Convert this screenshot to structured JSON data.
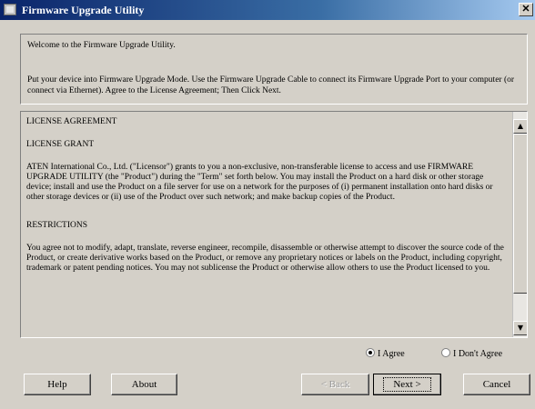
{
  "window": {
    "title": "Firmware Upgrade Utility",
    "close_glyph": "✕",
    "icon": "app-icon"
  },
  "intro": {
    "welcome": "Welcome to the Firmware Upgrade Utility.",
    "instructions": "Put your device into Firmware Upgrade Mode. Use the Firmware Upgrade Cable to connect its Firmware Upgrade Port to your computer (or connect via Ethernet). Agree to the License Agreement; Then Click Next."
  },
  "license": {
    "heading": "LICENSE AGREEMENT",
    "grant_heading": "LICENSE GRANT",
    "grant_text": "ATEN International Co., Ltd. (\"Licensor\") grants to you a non-exclusive, non-transferable license to access and use FIRMWARE UPGRADE UTILITY (the \"Product\") during the \"Term\" set forth below. You may install the Product on a hard disk or other storage device; install and use the Product on a file server for use on a network for the purposes of (i) permanent installation onto hard disks or other storage devices or (ii) use of the Product over such network; and make backup copies of the Product.",
    "restrictions_heading": "RESTRICTIONS",
    "restrictions_text": "You agree not to modify, adapt, translate, reverse engineer, recompile, disassemble or otherwise attempt to discover the source code of the Product, or create derivative works based on the Product, or remove any proprietary notices or labels on the Product, including copyright, trademark or patent pending notices. You may not sublicense the Product or otherwise allow others to use the Product licensed to you."
  },
  "scrollbar": {
    "up_glyph": "▲",
    "down_glyph": "▼"
  },
  "agreement": {
    "agree_label": "I Agree",
    "disagree_label": "I Don't Agree",
    "selected": "agree"
  },
  "buttons": {
    "help": "Help",
    "about": "About",
    "back": "< Back",
    "next": "Next >",
    "cancel": "Cancel"
  }
}
